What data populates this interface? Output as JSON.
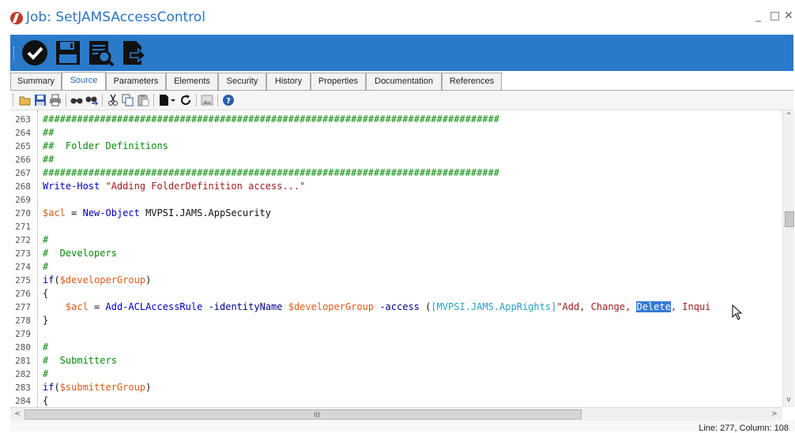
{
  "window": {
    "title": "Job: SetJAMSAccessControl",
    "minimize": "_",
    "maximize": "□",
    "close": "✕"
  },
  "ribbon": {
    "items": [
      "check-icon",
      "save-icon",
      "view-report-icon",
      "export-icon"
    ],
    "color": "#2a7ac9"
  },
  "tabs": [
    {
      "label": "Summary"
    },
    {
      "label": "Source"
    },
    {
      "label": "Parameters"
    },
    {
      "label": "Elements"
    },
    {
      "label": "Security"
    },
    {
      "label": "History"
    },
    {
      "label": "Properties"
    },
    {
      "label": "Documentation"
    },
    {
      "label": "References"
    }
  ],
  "active_tab": "Source",
  "editor_toolbar": [
    "open-icon",
    "save-icon",
    "print-icon",
    "find-icon",
    "replace-icon",
    "cut-icon",
    "copy-icon",
    "paste-icon",
    "new-doc-icon",
    "refresh-icon",
    "image-icon",
    "help-icon"
  ],
  "lines": [
    {
      "n": "263",
      "parts": [
        {
          "c": "c-comment",
          "t": "################################################################################"
        }
      ]
    },
    {
      "n": "264",
      "parts": [
        {
          "c": "c-comment",
          "t": "##"
        }
      ]
    },
    {
      "n": "265",
      "parts": [
        {
          "c": "c-comment",
          "t": "##  Folder Definitions"
        }
      ]
    },
    {
      "n": "266",
      "parts": [
        {
          "c": "c-comment",
          "t": "##"
        }
      ]
    },
    {
      "n": "267",
      "parts": [
        {
          "c": "c-comment",
          "t": "################################################################################"
        }
      ]
    },
    {
      "n": "268",
      "parts": [
        {
          "c": "c-cmd",
          "t": "Write-Host"
        },
        {
          "c": "",
          "t": " "
        },
        {
          "c": "c-str",
          "t": "\"Adding FolderDefinition access...\""
        }
      ]
    },
    {
      "n": "269",
      "parts": []
    },
    {
      "n": "270",
      "parts": [
        {
          "c": "c-var",
          "t": "$acl"
        },
        {
          "c": "",
          "t": " = "
        },
        {
          "c": "c-cmd",
          "t": "New-Object"
        },
        {
          "c": "",
          "t": " MVPSI.JAMS.AppSecurity"
        }
      ]
    },
    {
      "n": "271",
      "parts": []
    },
    {
      "n": "272",
      "parts": [
        {
          "c": "c-comment",
          "t": "#"
        }
      ]
    },
    {
      "n": "273",
      "parts": [
        {
          "c": "c-comment",
          "t": "#  Developers"
        }
      ]
    },
    {
      "n": "274",
      "parts": [
        {
          "c": "c-comment",
          "t": "#"
        }
      ]
    },
    {
      "n": "275",
      "parts": [
        {
          "c": "c-kw",
          "t": "if"
        },
        {
          "c": "",
          "t": "("
        },
        {
          "c": "c-var",
          "t": "$developerGroup"
        },
        {
          "c": "",
          "t": ")"
        }
      ]
    },
    {
      "n": "276",
      "parts": [
        {
          "c": "",
          "t": "{"
        }
      ]
    },
    {
      "n": "277",
      "parts": [
        {
          "c": "",
          "t": "    "
        },
        {
          "c": "c-var",
          "t": "$acl"
        },
        {
          "c": "",
          "t": " = "
        },
        {
          "c": "c-cmd",
          "t": "Add-ACLAccessRule"
        },
        {
          "c": "",
          "t": " "
        },
        {
          "c": "c-kw",
          "t": "-identityName"
        },
        {
          "c": "",
          "t": " "
        },
        {
          "c": "c-var",
          "t": "$developerGroup"
        },
        {
          "c": "",
          "t": " "
        },
        {
          "c": "c-kw",
          "t": "-access"
        },
        {
          "c": "",
          "t": " ("
        },
        {
          "c": "c-type",
          "t": "[MVPSI.JAMS.AppRights]"
        },
        {
          "c": "c-str",
          "t": "\"Add, Change, "
        },
        {
          "c": "c-sel",
          "t": "Delete"
        },
        {
          "c": "c-str",
          "t": ", Inqui"
        }
      ]
    },
    {
      "n": "278",
      "parts": [
        {
          "c": "",
          "t": "}"
        }
      ]
    },
    {
      "n": "279",
      "parts": []
    },
    {
      "n": "280",
      "parts": [
        {
          "c": "c-comment",
          "t": "#"
        }
      ]
    },
    {
      "n": "281",
      "parts": [
        {
          "c": "c-comment",
          "t": "#  Submitters"
        }
      ]
    },
    {
      "n": "282",
      "parts": [
        {
          "c": "c-comment",
          "t": "#"
        }
      ]
    },
    {
      "n": "283",
      "parts": [
        {
          "c": "c-kw",
          "t": "if"
        },
        {
          "c": "",
          "t": "("
        },
        {
          "c": "c-var",
          "t": "$submitterGroup"
        },
        {
          "c": "",
          "t": ")"
        }
      ]
    },
    {
      "n": "284",
      "parts": [
        {
          "c": "",
          "t": "{"
        }
      ]
    }
  ],
  "hscroll": {
    "left": "<",
    "right": ">",
    "grip": "III"
  },
  "vscroll": {
    "up": "^",
    "down": "v"
  },
  "status": {
    "text": "Line: 277, Column: 108"
  }
}
